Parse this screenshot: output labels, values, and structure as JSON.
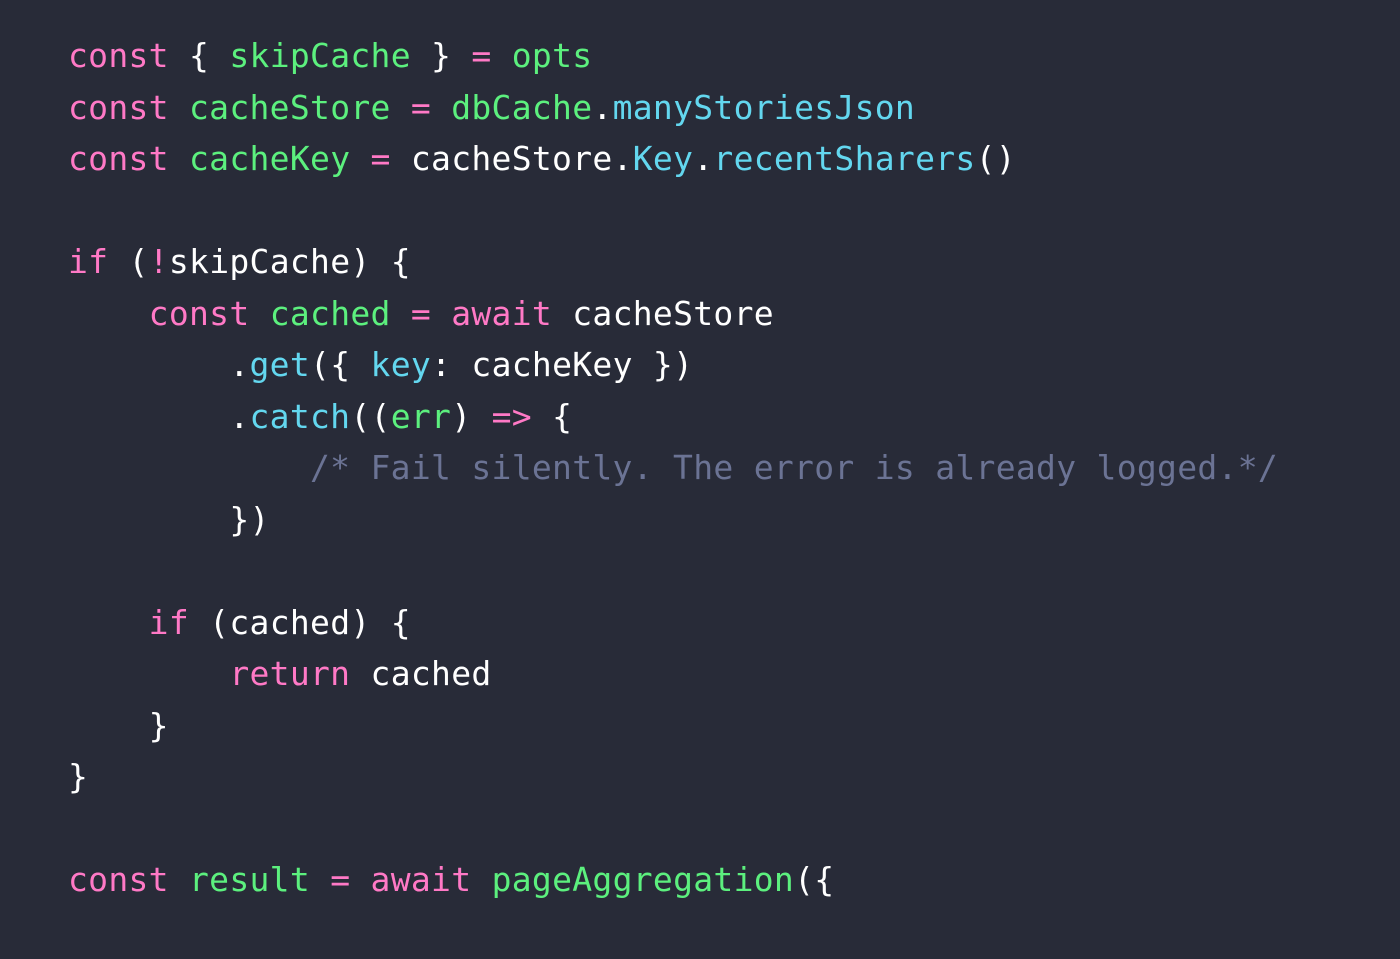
{
  "editor": {
    "language": "javascript",
    "background_color": "#282b38",
    "default_text_color": "#ffffff",
    "theme_colors": {
      "keyword": "#ff79c6",
      "variable": "#5cf07e",
      "property": "#63d7ef",
      "plain": "#ffffff",
      "comment": "#6b7394",
      "background": "#282b38"
    }
  },
  "lines": [
    {
      "number": 1,
      "text": "const { skipCache } = opts",
      "tokens": [
        {
          "text": "const",
          "kind": "keyword"
        },
        {
          "text": " ",
          "kind": "plain"
        },
        {
          "text": "{",
          "kind": "plain"
        },
        {
          "text": " ",
          "kind": "plain"
        },
        {
          "text": "skipCache",
          "kind": "variable"
        },
        {
          "text": " ",
          "kind": "plain"
        },
        {
          "text": "}",
          "kind": "plain"
        },
        {
          "text": " ",
          "kind": "plain"
        },
        {
          "text": "=",
          "kind": "keyword"
        },
        {
          "text": " ",
          "kind": "plain"
        },
        {
          "text": "opts",
          "kind": "variable"
        }
      ]
    },
    {
      "number": 2,
      "text": "const cacheStore = dbCache.manyStoriesJson",
      "tokens": [
        {
          "text": "const",
          "kind": "keyword"
        },
        {
          "text": " ",
          "kind": "plain"
        },
        {
          "text": "cacheStore",
          "kind": "variable"
        },
        {
          "text": " ",
          "kind": "plain"
        },
        {
          "text": "=",
          "kind": "keyword"
        },
        {
          "text": " ",
          "kind": "plain"
        },
        {
          "text": "dbCache",
          "kind": "variable"
        },
        {
          "text": ".",
          "kind": "plain"
        },
        {
          "text": "manyStoriesJson",
          "kind": "property"
        }
      ]
    },
    {
      "number": 3,
      "text": "const cacheKey = cacheStore.Key.recentSharers()",
      "tokens": [
        {
          "text": "const",
          "kind": "keyword"
        },
        {
          "text": " ",
          "kind": "plain"
        },
        {
          "text": "cacheKey",
          "kind": "variable"
        },
        {
          "text": " ",
          "kind": "plain"
        },
        {
          "text": "=",
          "kind": "keyword"
        },
        {
          "text": " ",
          "kind": "plain"
        },
        {
          "text": "cacheStore",
          "kind": "plain"
        },
        {
          "text": ".",
          "kind": "plain"
        },
        {
          "text": "Key",
          "kind": "property"
        },
        {
          "text": ".",
          "kind": "plain"
        },
        {
          "text": "recentSharers",
          "kind": "property"
        },
        {
          "text": "()",
          "kind": "plain"
        }
      ]
    },
    {
      "number": 4,
      "text": "",
      "tokens": []
    },
    {
      "number": 5,
      "text": "if (!skipCache) {",
      "tokens": [
        {
          "text": "if",
          "kind": "keyword"
        },
        {
          "text": " (",
          "kind": "plain"
        },
        {
          "text": "!",
          "kind": "keyword"
        },
        {
          "text": "skipCache",
          "kind": "plain"
        },
        {
          "text": ") {",
          "kind": "plain"
        }
      ]
    },
    {
      "number": 6,
      "text": "    const cached = await cacheStore",
      "tokens": [
        {
          "text": "    ",
          "kind": "plain"
        },
        {
          "text": "const",
          "kind": "keyword"
        },
        {
          "text": " ",
          "kind": "plain"
        },
        {
          "text": "cached",
          "kind": "variable"
        },
        {
          "text": " ",
          "kind": "plain"
        },
        {
          "text": "=",
          "kind": "keyword"
        },
        {
          "text": " ",
          "kind": "plain"
        },
        {
          "text": "await",
          "kind": "keyword"
        },
        {
          "text": " ",
          "kind": "plain"
        },
        {
          "text": "cacheStore",
          "kind": "plain"
        }
      ]
    },
    {
      "number": 7,
      "text": "        .get({ key: cacheKey })",
      "tokens": [
        {
          "text": "        .",
          "kind": "plain"
        },
        {
          "text": "get",
          "kind": "property"
        },
        {
          "text": "({ ",
          "kind": "plain"
        },
        {
          "text": "key",
          "kind": "property"
        },
        {
          "text": ": ",
          "kind": "plain"
        },
        {
          "text": "cacheKey",
          "kind": "plain"
        },
        {
          "text": " })",
          "kind": "plain"
        }
      ]
    },
    {
      "number": 8,
      "text": "        .catch((err) => {",
      "tokens": [
        {
          "text": "        .",
          "kind": "plain"
        },
        {
          "text": "catch",
          "kind": "property"
        },
        {
          "text": "((",
          "kind": "plain"
        },
        {
          "text": "err",
          "kind": "variable"
        },
        {
          "text": ") ",
          "kind": "plain"
        },
        {
          "text": "=>",
          "kind": "keyword"
        },
        {
          "text": " {",
          "kind": "plain"
        }
      ]
    },
    {
      "number": 9,
      "text": "            /* Fail silently. The error is already logged.*/",
      "tokens": [
        {
          "text": "            ",
          "kind": "plain"
        },
        {
          "text": "/* Fail silently. The error is already logged.*/",
          "kind": "comment"
        }
      ]
    },
    {
      "number": 10,
      "text": "        })",
      "tokens": [
        {
          "text": "        })",
          "kind": "plain"
        }
      ]
    },
    {
      "number": 11,
      "text": "",
      "tokens": []
    },
    {
      "number": 12,
      "text": "    if (cached) {",
      "tokens": [
        {
          "text": "    ",
          "kind": "plain"
        },
        {
          "text": "if",
          "kind": "keyword"
        },
        {
          "text": " (",
          "kind": "plain"
        },
        {
          "text": "cached",
          "kind": "plain"
        },
        {
          "text": ") {",
          "kind": "plain"
        }
      ]
    },
    {
      "number": 13,
      "text": "        return cached",
      "tokens": [
        {
          "text": "        ",
          "kind": "plain"
        },
        {
          "text": "return",
          "kind": "keyword"
        },
        {
          "text": " ",
          "kind": "plain"
        },
        {
          "text": "cached",
          "kind": "plain"
        }
      ]
    },
    {
      "number": 14,
      "text": "    }",
      "tokens": [
        {
          "text": "    }",
          "kind": "plain"
        }
      ]
    },
    {
      "number": 15,
      "text": "}",
      "tokens": [
        {
          "text": "}",
          "kind": "plain"
        }
      ]
    },
    {
      "number": 16,
      "text": "",
      "tokens": []
    },
    {
      "number": 17,
      "text": "const result = await pageAggregation({",
      "tokens": [
        {
          "text": "const",
          "kind": "keyword"
        },
        {
          "text": " ",
          "kind": "plain"
        },
        {
          "text": "result",
          "kind": "variable"
        },
        {
          "text": " ",
          "kind": "plain"
        },
        {
          "text": "=",
          "kind": "keyword"
        },
        {
          "text": " ",
          "kind": "plain"
        },
        {
          "text": "await",
          "kind": "keyword"
        },
        {
          "text": " ",
          "kind": "plain"
        },
        {
          "text": "pageAggregation",
          "kind": "variable"
        },
        {
          "text": "({",
          "kind": "plain"
        }
      ]
    }
  ]
}
